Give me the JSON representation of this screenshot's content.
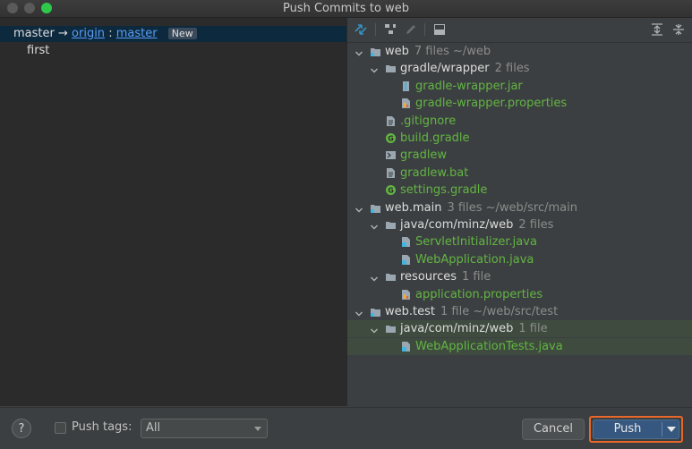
{
  "window": {
    "title": "Push Commits to web"
  },
  "commits": {
    "branch": {
      "local": "master",
      "arrow": "→",
      "remote": "origin",
      "sep": ":",
      "remote_branch": "master",
      "badge": "New"
    },
    "items": [
      "first"
    ]
  },
  "tree": [
    {
      "name": "web",
      "meta": "7 files  ~/web",
      "type": "module",
      "level": 0,
      "expanded": true
    },
    {
      "name": "gradle/wrapper",
      "meta": "2 files",
      "type": "folder",
      "level": 1,
      "expanded": true
    },
    {
      "name": "gradle-wrapper.jar",
      "type": "jar",
      "level": 2,
      "changed": true
    },
    {
      "name": "gradle-wrapper.properties",
      "type": "props",
      "level": 2,
      "changed": true
    },
    {
      "name": ".gitignore",
      "type": "text",
      "level": 1,
      "changed": true
    },
    {
      "name": "build.gradle",
      "type": "gradle",
      "level": 1,
      "changed": true
    },
    {
      "name": "gradlew",
      "type": "shell",
      "level": 1,
      "changed": true
    },
    {
      "name": "gradlew.bat",
      "type": "text",
      "level": 1,
      "changed": true
    },
    {
      "name": "settings.gradle",
      "type": "gradle",
      "level": 1,
      "changed": true
    },
    {
      "name": "web.main",
      "meta": "3 files  ~/web/src/main",
      "type": "module",
      "level": 0,
      "expanded": true
    },
    {
      "name": "java/com/minz/web",
      "meta": "2 files",
      "type": "folder",
      "level": 1,
      "expanded": true
    },
    {
      "name": "ServletInitializer.java",
      "type": "java",
      "level": 2,
      "changed": true
    },
    {
      "name": "WebApplication.java",
      "type": "java",
      "level": 2,
      "changed": true
    },
    {
      "name": "resources",
      "meta": "1 file",
      "type": "folder",
      "level": 1,
      "expanded": true
    },
    {
      "name": "application.properties",
      "type": "props",
      "level": 2,
      "changed": true
    },
    {
      "name": "web.test",
      "meta": "1 file  ~/web/src/test",
      "type": "module",
      "level": 0,
      "expanded": true
    },
    {
      "name": "java/com/minz/web",
      "meta": "1 file",
      "type": "folder",
      "level": 1,
      "expanded": true,
      "highlight": true
    },
    {
      "name": "WebApplicationTests.java",
      "type": "java",
      "level": 2,
      "changed": true,
      "highlight": true
    }
  ],
  "footer": {
    "help": "?",
    "push_tags_label": "Push tags:",
    "push_tags_value": "All",
    "cancel": "Cancel",
    "push": "Push"
  },
  "colors": {
    "accent": "#365880",
    "changed_file": "#62b543",
    "focus_outline": "#e8672a",
    "link": "#589df6"
  },
  "icons": {
    "toolbar": [
      "diff-icon",
      "group-by-icon",
      "edit-icon",
      "commit-details-icon",
      "expand-all-icon",
      "collapse-all-icon"
    ]
  }
}
